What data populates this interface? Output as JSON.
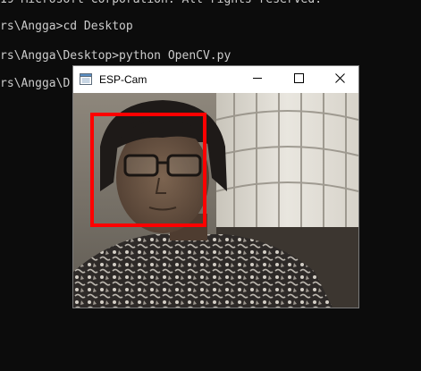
{
  "terminal": {
    "lines": [
      "19 Microsoft Corporation. All rights reserved.",
      "rs\\Angga>cd Desktop",
      "rs\\Angga\\Desktop>python OpenCV.py",
      "rs\\Angga\\D"
    ]
  },
  "window": {
    "title": "ESP-Cam",
    "icon": "window-app-icon",
    "controls": [
      "minimize-icon",
      "maximize-icon",
      "close-icon"
    ]
  },
  "detection": {
    "box_color": "#ff0000",
    "label": "face"
  },
  "colors": {
    "terminal_bg": "#0c0c0c",
    "terminal_text": "#cccccc",
    "titlebar_bg": "#ffffff",
    "detection_box": "#ff0000"
  }
}
